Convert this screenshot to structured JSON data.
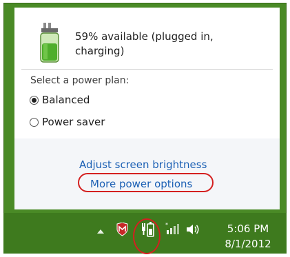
{
  "battery": {
    "icon": "battery-plugged-icon",
    "status_line1": "59% available (plugged in,",
    "status_line2": "charging)",
    "percent": 59
  },
  "power_plan": {
    "heading": "Select a power plan:",
    "options": [
      {
        "label": "Balanced",
        "selected": true
      },
      {
        "label": "Power saver",
        "selected": false
      }
    ]
  },
  "links": {
    "adjust_brightness": "Adjust screen brightness",
    "more_power_options": "More power options"
  },
  "taskbar": {
    "icons": [
      "show-hidden-icons-icon",
      "antivirus-shield-icon",
      "power-icon",
      "network-icon",
      "volume-icon"
    ],
    "time": "5:06 PM",
    "date": "8/1/2012"
  },
  "colors": {
    "accent_green": "#4a8a26",
    "taskbar_green": "#3e7a1e",
    "link_blue": "#1a5fb4",
    "highlight_red": "#d42020"
  }
}
